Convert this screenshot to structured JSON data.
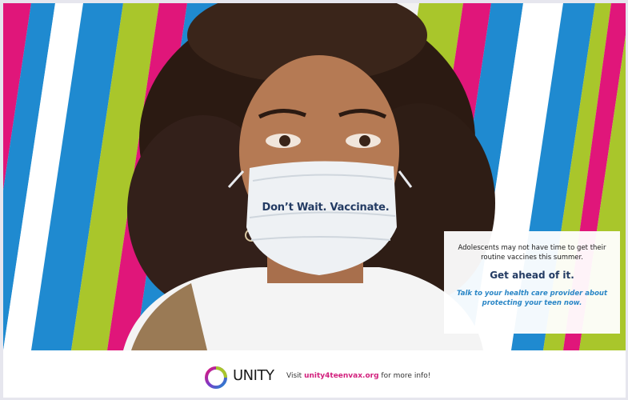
{
  "hero": {
    "tagline": "Don’t Wait. Vaccinate.",
    "stripe_colors": [
      "#1f8ad0",
      "#a9c62b",
      "#e0167a",
      "#ffffff"
    ]
  },
  "info_card": {
    "lead": "Adolescents may not have time to get their routine vaccines this summer.",
    "heading": "Get ahead of it.",
    "cta": "Talk to your health care provider about protecting your teen now."
  },
  "footer": {
    "logo_text": "UNITY",
    "visit_prefix": "Visit",
    "link_text": "unity4teenvax.org",
    "visit_suffix": "for more info!"
  },
  "colors": {
    "navy": "#233b63",
    "link_pink": "#d2207d",
    "cta_blue": "#2a86c6"
  }
}
